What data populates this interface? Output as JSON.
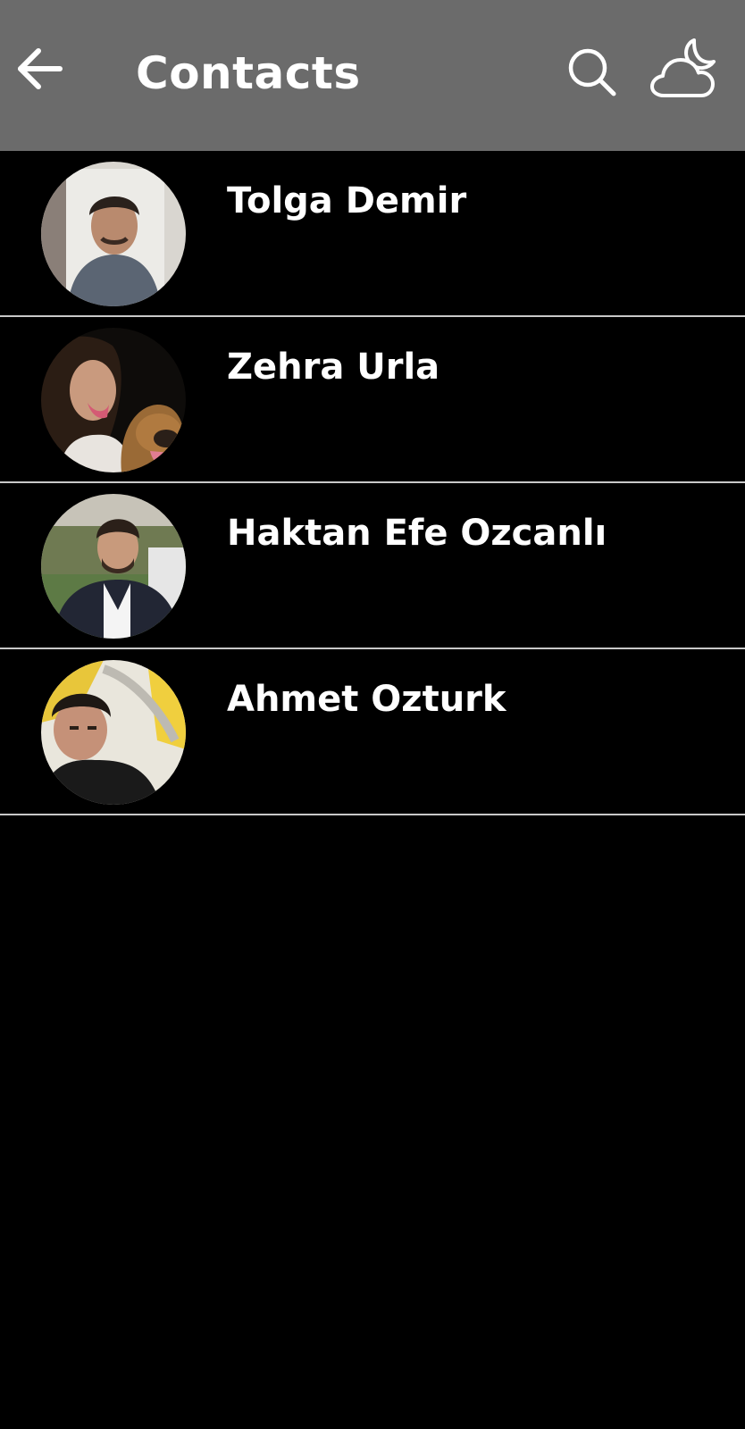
{
  "header": {
    "title": "Contacts",
    "back_icon": "arrow-left-icon",
    "search_icon": "search-icon",
    "theme_icon": "cloud-moon-icon",
    "background_color": "#6b6b6b",
    "text_color": "#ffffff"
  },
  "contacts": [
    {
      "name": "Tolga Demir"
    },
    {
      "name": "Zehra Urla"
    },
    {
      "name": "Haktan Efe Ozcanlı"
    },
    {
      "name": "Ahmet Ozturk"
    }
  ],
  "colors": {
    "background": "#000000",
    "divider": "#c8c8c8",
    "name_text": "#ffffff"
  }
}
